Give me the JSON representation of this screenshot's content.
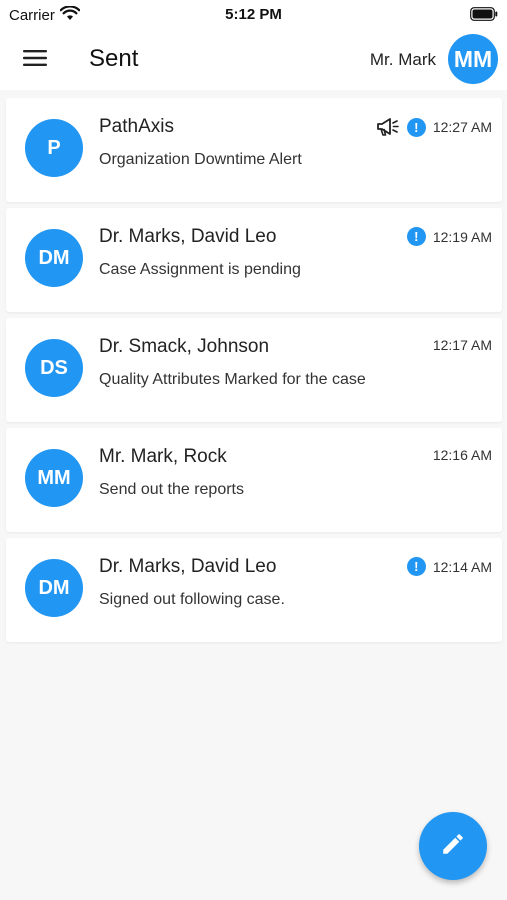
{
  "status_bar": {
    "carrier": "Carrier",
    "time": "5:12 PM"
  },
  "header": {
    "title": "Sent",
    "user_name": "Mr. Mark",
    "user_initials": "MM"
  },
  "messages": [
    {
      "initials": "P",
      "sender": "PathAxis",
      "subject": "Organization Downtime Alert",
      "time": "12:27 AM",
      "alert": true,
      "broadcast": true
    },
    {
      "initials": "DM",
      "sender": "Dr. Marks, David Leo",
      "subject": "Case Assignment is pending",
      "time": "12:19 AM",
      "alert": true,
      "broadcast": false
    },
    {
      "initials": "DS",
      "sender": "Dr. Smack, Johnson",
      "subject": "Quality Attributes Marked for the case",
      "time": "12:17 AM",
      "alert": false,
      "broadcast": false
    },
    {
      "initials": "MM",
      "sender": "Mr. Mark, Rock",
      "subject": "Send out the reports",
      "time": "12:16 AM",
      "alert": false,
      "broadcast": false
    },
    {
      "initials": "DM",
      "sender": "Dr. Marks, David Leo",
      "subject": "Signed out following case.",
      "time": "12:14 AM",
      "alert": true,
      "broadcast": false
    }
  ],
  "icons": {
    "menu": "hamburger-menu-icon",
    "compose": "pencil-icon",
    "alert": "exclamation-icon",
    "broadcast": "megaphone-icon"
  },
  "colors": {
    "accent": "#2196f3"
  }
}
